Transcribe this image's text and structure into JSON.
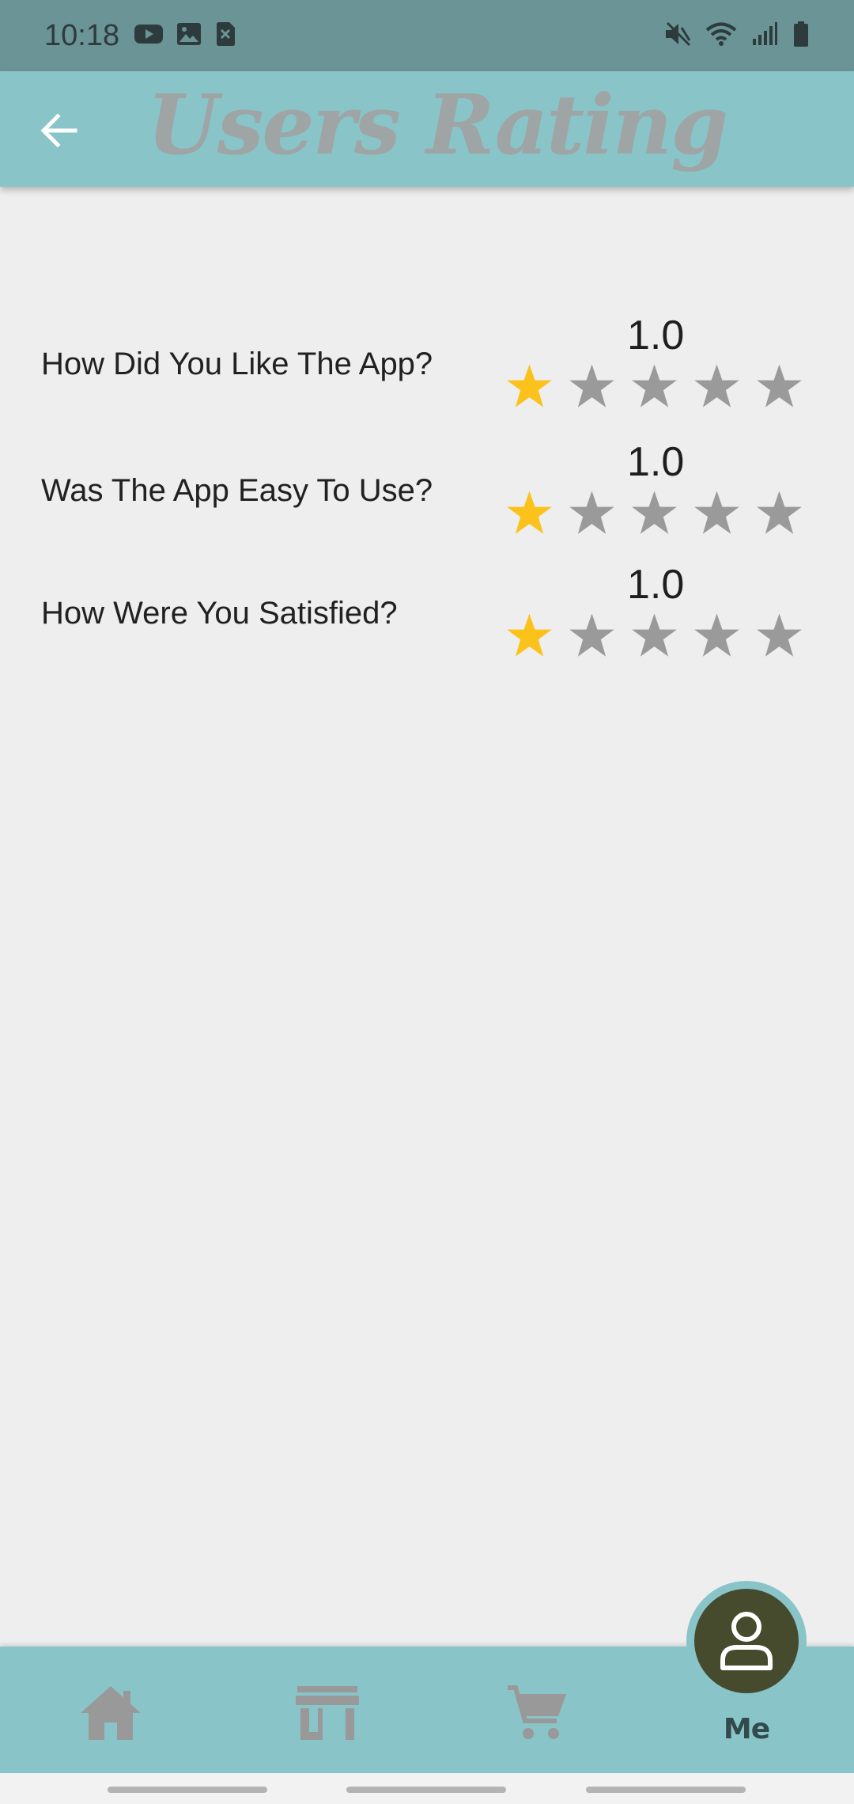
{
  "status_bar": {
    "time": "10:18",
    "left_icons": [
      "youtube-icon",
      "image-icon",
      "sim-off-icon"
    ],
    "right_icons": [
      "mute-icon",
      "wifi-icon",
      "signal-icon",
      "battery-icon"
    ]
  },
  "app_bar": {
    "title": "Users Rating",
    "back_icon": "arrow-left-icon",
    "background": "#88c4c8",
    "title_color": "#9fa4a4"
  },
  "ratings": [
    {
      "question": "How Did You Like The App?",
      "value_label": "1.0",
      "value": 1,
      "max": 5
    },
    {
      "question": "Was The App Easy To Use?",
      "value_label": "1.0",
      "value": 1,
      "max": 5
    },
    {
      "question": "How Were You Satisfied?",
      "value_label": "1.0",
      "value": 1,
      "max": 5
    }
  ],
  "star_colors": {
    "filled": "#fbc21b",
    "empty": "#9a9a9a"
  },
  "bottom_nav": {
    "items": [
      {
        "icon": "home-icon"
      },
      {
        "icon": "store-icon"
      },
      {
        "icon": "cart-icon"
      }
    ],
    "me": {
      "icon": "person-icon",
      "label": "Me"
    },
    "active_color": "#464b2e",
    "inactive_color": "#999999"
  }
}
